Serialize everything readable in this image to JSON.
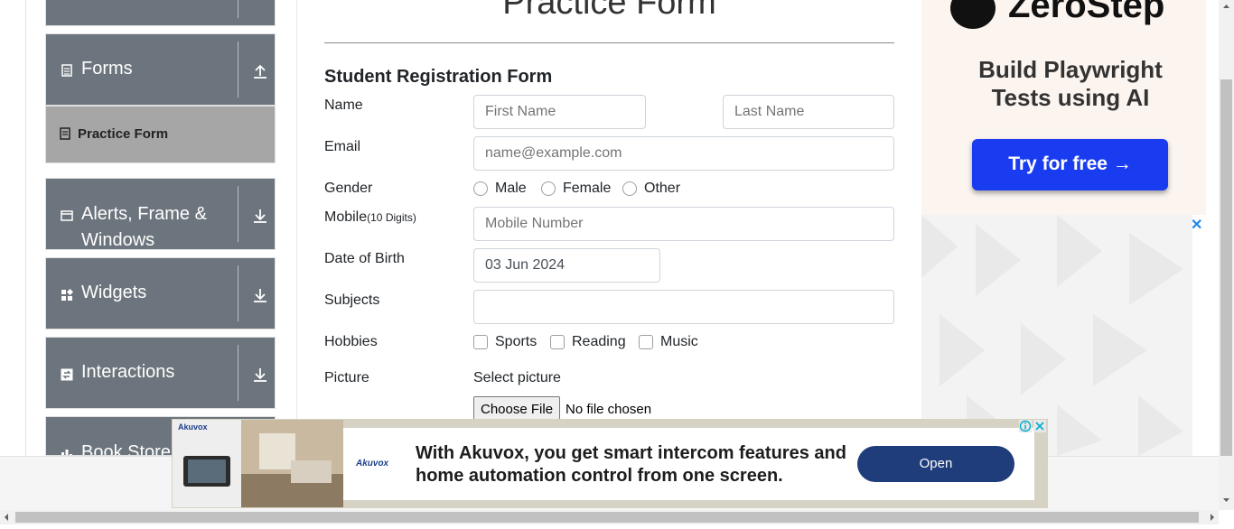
{
  "sidebar": {
    "groups": [
      {
        "label": ""
      },
      {
        "label": "Forms"
      },
      {
        "label": "Alerts, Frame & Windows"
      },
      {
        "label": "Widgets"
      },
      {
        "label": "Interactions"
      },
      {
        "label": "Book Store"
      }
    ],
    "active_item": "Practice Form"
  },
  "main": {
    "title": "Practice Form",
    "form_heading": "Student Registration Form",
    "name": {
      "label": "Name",
      "first_placeholder": "First Name",
      "last_placeholder": "Last Name"
    },
    "email": {
      "label": "Email",
      "placeholder": "name@example.com"
    },
    "gender": {
      "label": "Gender",
      "options": [
        "Male",
        "Female",
        "Other"
      ]
    },
    "mobile": {
      "label": "Mobile",
      "hint": "(10 Digits)",
      "placeholder": "Mobile Number"
    },
    "dob": {
      "label": "Date of Birth",
      "value": "03 Jun 2024"
    },
    "subjects": {
      "label": "Subjects",
      "value": ""
    },
    "hobbies": {
      "label": "Hobbies",
      "options": [
        "Sports",
        "Reading",
        "Music"
      ]
    },
    "picture": {
      "label": "Picture",
      "select_label": "Select picture",
      "button": "Choose File",
      "status": "No file chosen"
    }
  },
  "side_ad": {
    "brand": "ZeroStep",
    "tagline": "Build Playwright Tests using AI",
    "cta": "Try for free →",
    "close": "✕"
  },
  "banner_ad": {
    "thumb_brand": "Akuvox",
    "logo": "Akuvox",
    "text": "With Akuvox, you get smart intercom features and home automation control from one screen.",
    "cta": "Open"
  },
  "colors": {
    "sidebar_bg": "#6c757d",
    "active_item_bg": "#a6a6a6",
    "cta_blue": "#1a3cf0",
    "banner_btn": "#1f3d7a"
  }
}
